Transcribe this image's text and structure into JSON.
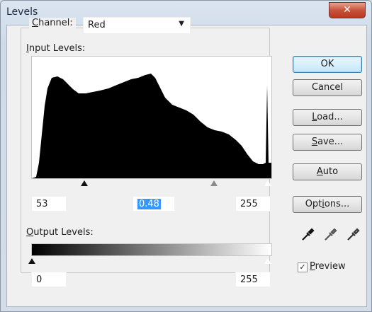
{
  "window": {
    "title": "Levels"
  },
  "channel": {
    "label_prefix": "C",
    "label_rest": "hannel:",
    "value": "Red"
  },
  "input_levels": {
    "label_prefix": "I",
    "label_rest": "nput Levels:",
    "black": "53",
    "gamma": "0.48",
    "white": "255"
  },
  "output_levels": {
    "label_prefix": "O",
    "label_rest": "utput Levels:",
    "black": "0",
    "white": "255"
  },
  "buttons": {
    "ok": "OK",
    "cancel": "Cancel",
    "load_prefix": "L",
    "load_rest": "oad...",
    "save_prefix": "S",
    "save_rest": "ave...",
    "auto_prefix": "A",
    "auto_rest": "uto",
    "options_a": "Opt",
    "options_u": "i",
    "options_b": "ons..."
  },
  "preview": {
    "label_prefix": "P",
    "label_rest": "review",
    "checked": true
  },
  "icons": {
    "black_eyedropper": "eyedropper-black-icon",
    "gray_eyedropper": "eyedropper-gray-icon",
    "white_eyedropper": "eyedropper-white-icon"
  }
}
